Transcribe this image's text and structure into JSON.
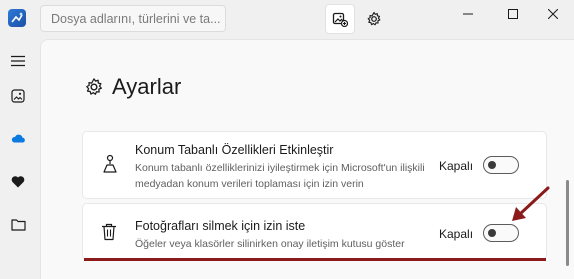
{
  "titlebar": {
    "search": {
      "placeholder": "Dosya adlarını, türlerini ve ta..."
    },
    "buttons": [
      "photo-edit-icon",
      "gear-icon"
    ],
    "window_controls": [
      "minimize-icon",
      "maximize-icon",
      "close-icon"
    ]
  },
  "nav": {
    "items": [
      "hamburger-menu-icon",
      "photos-icon",
      "onedrive-cloud-icon",
      "heart-icon",
      "folder-icon"
    ]
  },
  "settings": {
    "heading": "Ayarlar",
    "items": [
      {
        "title": "Konum Tabanlı Özellikleri Etkinleştir",
        "description": "Konum tabanlı özelliklerinizi iyileştirmek için Microsoft'un ilişkili medyadan konum verileri toplaması için izin verin",
        "state": "Kapalı",
        "on": false,
        "icon": "location-person-icon"
      },
      {
        "title": "Fotoğrafları silmek için izin iste",
        "description": "Öğeler veya klasörler silinirken onay iletişim kutusu göster",
        "state": "Kapalı",
        "on": false,
        "icon": "trash-icon"
      }
    ]
  },
  "annotation": {
    "color": "#8b1a1a"
  },
  "colors": {
    "accent": "#0f6cbd",
    "onedrive": "#0a7ae0",
    "annotation": "#8b1a1a"
  }
}
